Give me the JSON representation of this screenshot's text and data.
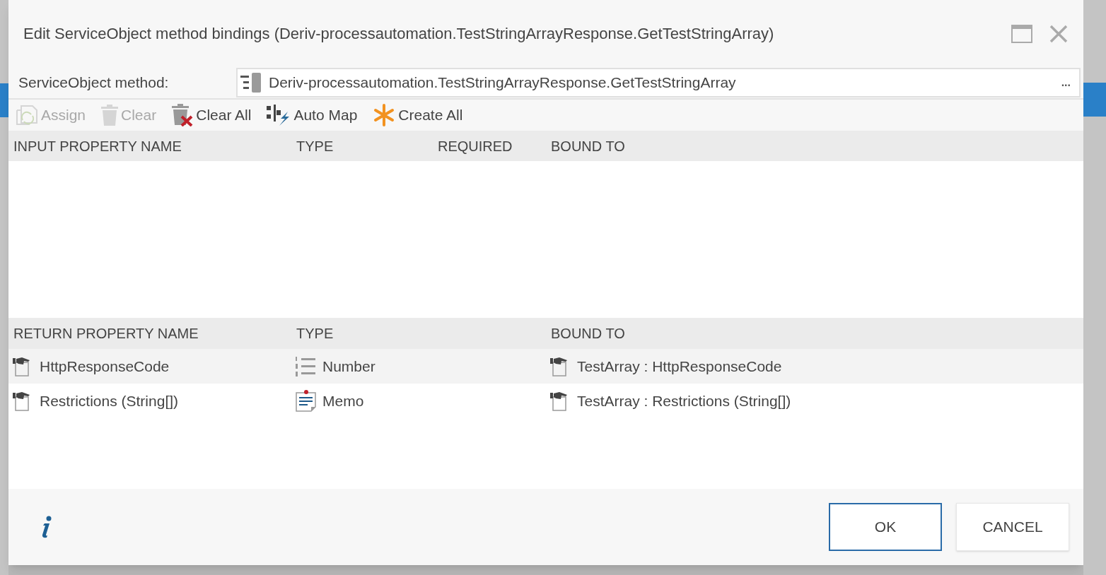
{
  "dialog": {
    "title": "Edit ServiceObject method bindings (Deriv-processautomation.TestStringArrayResponse.GetTestStringArray)"
  },
  "method": {
    "label": "ServiceObject method:",
    "value": "Deriv-processautomation.TestStringArrayResponse.GetTestStringArray",
    "more": "..."
  },
  "toolbar": [
    {
      "kind": "assign",
      "label": "Assign",
      "disabled": true
    },
    {
      "kind": "clear",
      "label": "Clear",
      "disabled": true
    },
    {
      "kind": "clear_all",
      "label": "Clear All",
      "disabled": false
    },
    {
      "kind": "auto_map",
      "label": "Auto Map",
      "disabled": false
    },
    {
      "kind": "create_all",
      "label": "Create All",
      "disabled": false
    }
  ],
  "input_table": {
    "columns": [
      "INPUT PROPERTY NAME",
      "TYPE",
      "REQUIRED",
      "BOUND TO"
    ]
  },
  "return_table": {
    "columns": [
      "RETURN PROPERTY NAME",
      "TYPE",
      "BOUND TO"
    ],
    "rows": [
      {
        "name": "HttpResponseCode",
        "kind": "number",
        "type": "Number",
        "bound_to": "TestArray : HttpResponseCode"
      },
      {
        "name": "Restrictions (String[])",
        "kind": "memo",
        "type": "Memo",
        "bound_to": "TestArray : Restrictions (String[])"
      }
    ]
  },
  "buttons": [
    {
      "label": "OK",
      "selected": true
    },
    {
      "label": "CANCEL",
      "selected": false
    }
  ]
}
